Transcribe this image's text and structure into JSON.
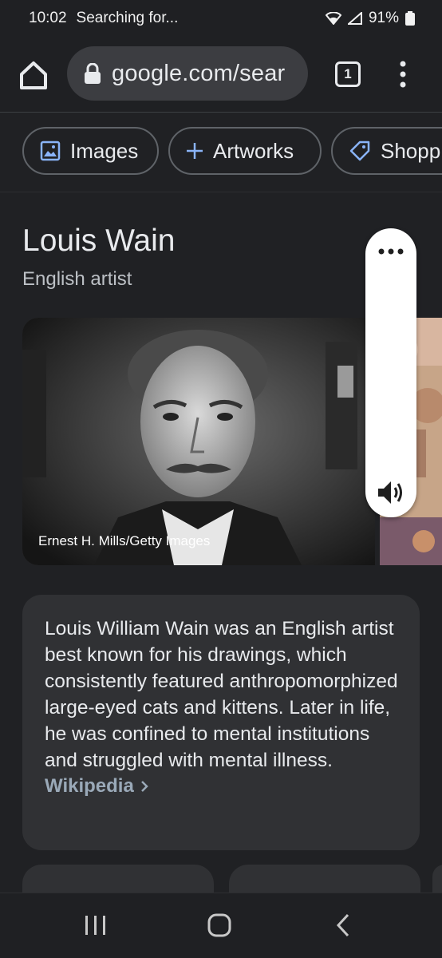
{
  "status_bar": {
    "time": "10:02",
    "notification": "Searching for...",
    "battery": "91%"
  },
  "browser": {
    "url": "google.com/sear",
    "tab_count": "1",
    "icons": [
      "home-icon",
      "lock-icon",
      "tabs-icon",
      "more-vert-icon"
    ]
  },
  "chips": [
    {
      "label": "Images",
      "icon": "image-icon"
    },
    {
      "label": "Artworks",
      "icon": "plus-icon"
    },
    {
      "label": "Shopp",
      "icon": "tag-icon"
    }
  ],
  "knowledge_panel": {
    "title": "Louis Wain",
    "subtitle": "English artist",
    "photo_credit": "Ernest H. Mills/Getty Images",
    "description": "Louis William Wain was an English artist best known for his drawings, which consistently featured anthropomorphized large-eyed cats and kittens. Later in life, he was confined to mental institutions and struggled with mental illness.",
    "source_link": "Wikipedia"
  },
  "floating_widget": {
    "icons": [
      "more-horiz-icon",
      "speaker-icon"
    ]
  },
  "nav": {
    "icons": [
      "recent-apps-icon",
      "home-nav-icon",
      "back-icon"
    ]
  },
  "colors": {
    "background": "#202124",
    "card": "#303134",
    "text": "#e8eaed",
    "chip_icon": "#8ab4f8"
  }
}
